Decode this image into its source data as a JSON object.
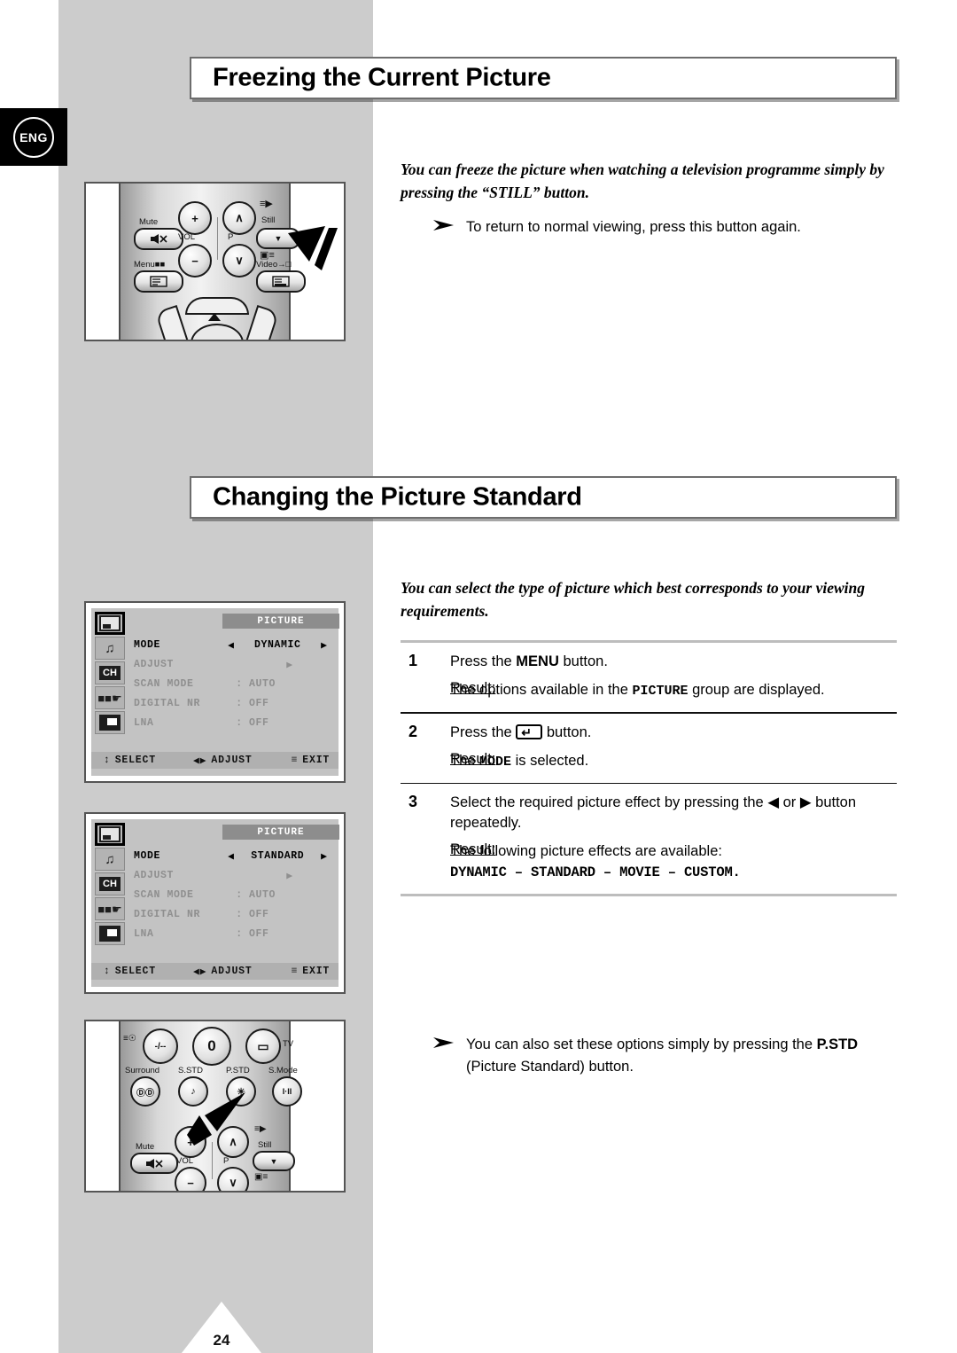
{
  "page": {
    "language_badge": "ENG",
    "page_number": "24"
  },
  "sections": [
    {
      "title": "Freezing the Current Picture",
      "intro": "You can freeze the picture when watching a television programme simply by pressing the “STILL” button.",
      "note": "To return to normal viewing, press this button again."
    },
    {
      "title": "Changing the Picture Standard",
      "intro": "You can select the type of picture which best corresponds to your viewing requirements.",
      "note_prefix": "You can also set these options simply by pressing the ",
      "note_bold": "P.STD",
      "note_suffix": " (Picture Standard) button."
    }
  ],
  "steps": [
    {
      "number": "1",
      "text_before": "Press the ",
      "text_bold": "MENU",
      "text_after": " button.",
      "result_label": "Result:",
      "result_before": "The options available in the ",
      "result_mono": "PICTURE",
      "result_after": " group are displayed."
    },
    {
      "number": "2",
      "text_before": "Press the ",
      "text_icon": "enter-key-icon",
      "text_after": " button.",
      "result_label": "Result:",
      "result_before": "The ",
      "result_mono": "MODE",
      "result_after": " is selected."
    },
    {
      "number": "3",
      "text_before": "Select the required picture effect by pressing the ",
      "text_left_arrow": "◀",
      "text_or": " or ",
      "text_right_arrow": "▶",
      "text_after": " button repeatedly.",
      "result_label": "Result:",
      "result_before": "The following picture effects are available:",
      "result_effects": "DYNAMIC – STANDARD – MOVIE – CUSTOM."
    }
  ],
  "osd_screens": [
    {
      "title": "PICTURE",
      "icons": [
        "picture-icon",
        "sound-icon",
        "channel-icon",
        "function-icon",
        "pip-icon"
      ],
      "selected_icon_index": 0,
      "rows": [
        {
          "key": "MODE",
          "left_arrow": "◀",
          "value": "DYNAMIC",
          "right_arrow": "▶",
          "active": true
        },
        {
          "key": "ADJUST",
          "value": "▶",
          "active": false
        },
        {
          "key": "SCAN MODE",
          "colon": ":",
          "value": "AUTO",
          "active": false
        },
        {
          "key": "DIGITAL NR",
          "colon": ":",
          "value": "OFF",
          "active": false
        },
        {
          "key": "LNA",
          "colon": ":",
          "value": "OFF",
          "active": false
        }
      ],
      "bar": {
        "select": "SELECT",
        "adjust": "ADJUST",
        "exit": "EXIT",
        "select_glyph": "↕",
        "adjust_glyph": "◀▶",
        "exit_glyph": "≡"
      }
    },
    {
      "title": "PICTURE",
      "icons": [
        "picture-icon",
        "sound-icon",
        "channel-icon",
        "function-icon",
        "pip-icon"
      ],
      "selected_icon_index": 0,
      "rows": [
        {
          "key": "MODE",
          "left_arrow": "◀",
          "value": "STANDARD",
          "right_arrow": "▶",
          "active": true
        },
        {
          "key": "ADJUST",
          "value": "▶",
          "active": false
        },
        {
          "key": "SCAN MODE",
          "colon": ":",
          "value": "AUTO",
          "active": false
        },
        {
          "key": "DIGITAL NR",
          "colon": ":",
          "value": "OFF",
          "active": false
        },
        {
          "key": "LNA",
          "colon": ":",
          "value": "OFF",
          "active": false
        }
      ],
      "bar": {
        "select": "SELECT",
        "adjust": "ADJUST",
        "exit": "EXIT",
        "select_glyph": "↕",
        "adjust_glyph": "◀▶",
        "exit_glyph": "≡"
      }
    }
  ],
  "remote_top": {
    "labels": {
      "mute": "Mute",
      "vol": "VOL",
      "p": "P",
      "still": "Still",
      "menu": "Menu",
      "video": "Video"
    },
    "buttons": {
      "vol_up": "+",
      "vol_down": "−",
      "p_up": "∧",
      "p_down": "∨",
      "mute": "Ø",
      "still": "▼",
      "menu": "☰",
      "video": "▤"
    }
  },
  "remote_bottom": {
    "labels": {
      "surround": "Surround",
      "sstd": "S.STD",
      "pstd": "P.STD",
      "smode": "S.Mode",
      "tv": "TV",
      "mute": "Mute",
      "vol": "VOL",
      "p": "P",
      "still": "Still"
    },
    "buttons": {
      "prech": "-/--",
      "zero": "0",
      "tv": "▭",
      "surround": "ⒹⒹ",
      "sstd": "♪",
      "pstd": "☀",
      "smode": "I·II",
      "vol_up": "+",
      "vol_down": "−",
      "p_up": "∧",
      "p_down": "∨",
      "mute": "Ø",
      "still": "▼"
    }
  },
  "colors": {
    "panel_gray": "#cccccc",
    "osd_bg": "#c3c3c3",
    "osd_title_bar": "#8d8d8d",
    "osd_bottom_bar": "#b0b0b0",
    "badge_bg": "#000000"
  }
}
